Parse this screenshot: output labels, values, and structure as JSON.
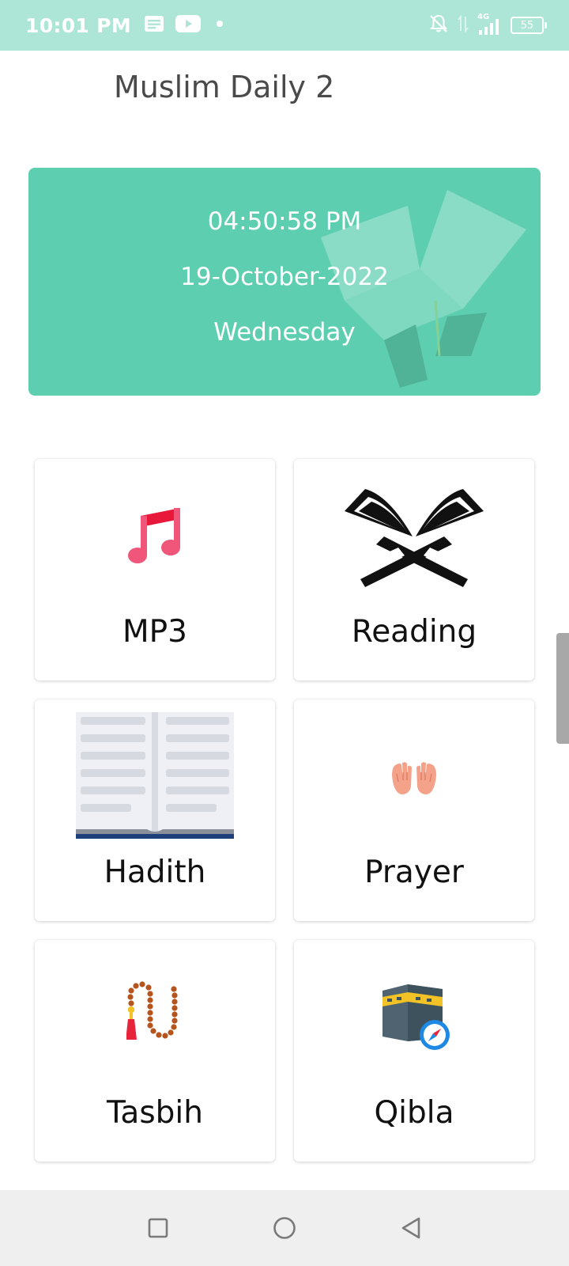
{
  "status_bar": {
    "time": "10:01 PM",
    "network": "4G",
    "battery": "55"
  },
  "app": {
    "title": "Muslim Daily 2"
  },
  "datetime_card": {
    "time": "04:50:58 PM",
    "date": "19-October-2022",
    "day": "Wednesday"
  },
  "menu": {
    "items": [
      {
        "label": "MP3",
        "icon": "music-note-icon"
      },
      {
        "label": "Reading",
        "icon": "quran-stand-icon"
      },
      {
        "label": "Hadith",
        "icon": "open-book-icon"
      },
      {
        "label": "Prayer",
        "icon": "praying-hands-icon"
      },
      {
        "label": "Tasbih",
        "icon": "prayer-beads-icon"
      },
      {
        "label": "Qibla",
        "icon": "kaaba-compass-icon"
      }
    ]
  },
  "colors": {
    "status_bar": "#ade6d6",
    "card_accent": "#5dcfb0",
    "music_icon": "#f0557a"
  }
}
